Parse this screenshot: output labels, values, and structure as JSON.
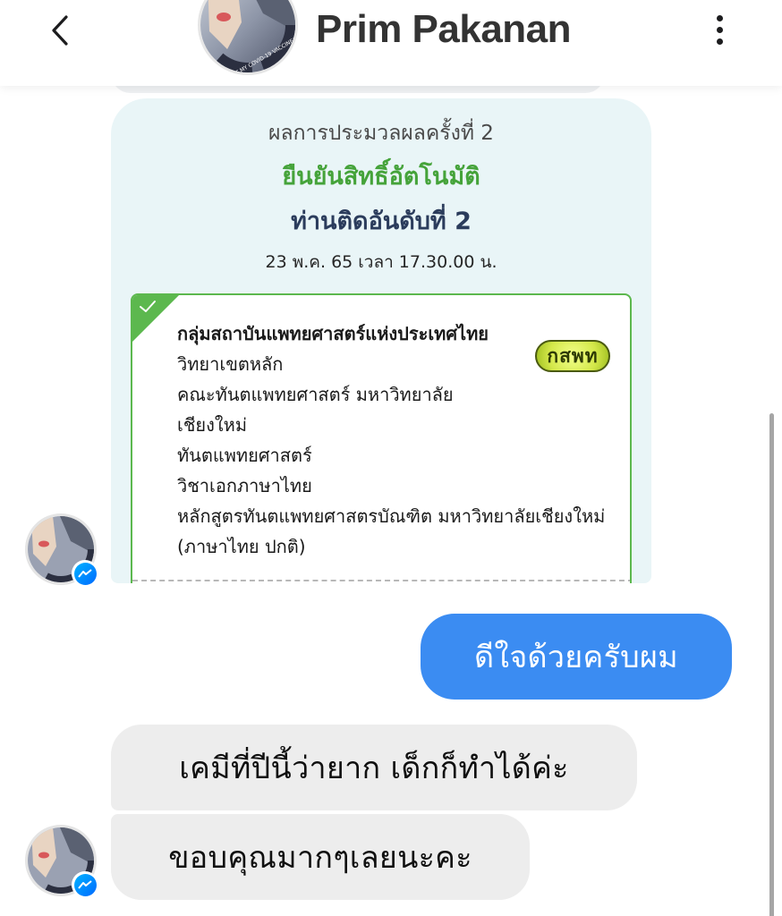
{
  "header": {
    "contact_name": "Prim Pakanan",
    "back_icon": "chevron-left-icon",
    "more_icon": "vertical-ellipsis-icon",
    "avatar_badge_text": "I GOT MY COVID-19 VACCINE!"
  },
  "result_card": {
    "heading": "ผลการประมวลผลครั้งที่ 2",
    "status": "ยืนยันสิทธิ์อัตโนมัติ",
    "rank": "ท่านติดอันดับที่ 2",
    "date": "23 พ.ค. 65 เวลา 17.30.00 น.",
    "choice": {
      "group": "กลุ่มสถาบันแพทยศาสตร์แห่งประเทศไทย",
      "campus": "วิทยาเขตหลัก",
      "faculty": "คณะทันตแพทยศาสตร์ มหาวิทยาลัย",
      "faculty_cont": "เชียงใหม่",
      "program": "ทันตแพทยศาสตร์",
      "major": "วิชาเอกภาษาไทย",
      "curriculum": "หลักสูตรทันตแพทยศาสตรบัณฑิต มหาวิทยาลัยเชียงใหม่",
      "track": "(ภาษาไทย ปกติ)",
      "logo_text": "กสพท"
    }
  },
  "messages": [
    {
      "direction": "sent",
      "text": "ดีใจด้วยครับผม"
    },
    {
      "direction": "received",
      "text": "เคมีที่ปีนี้ว่ายาก เด็กก็ทำได้ค่ะ"
    },
    {
      "direction": "received",
      "text": "ขอบคุณมากๆเลยนะคะ"
    }
  ],
  "colors": {
    "sent_bubble": "#3b8cf2",
    "received_bubble": "#ededed",
    "status_green": "#45a33a",
    "rank_navy": "#2b3c5c",
    "messenger_badge": "#006aff"
  }
}
